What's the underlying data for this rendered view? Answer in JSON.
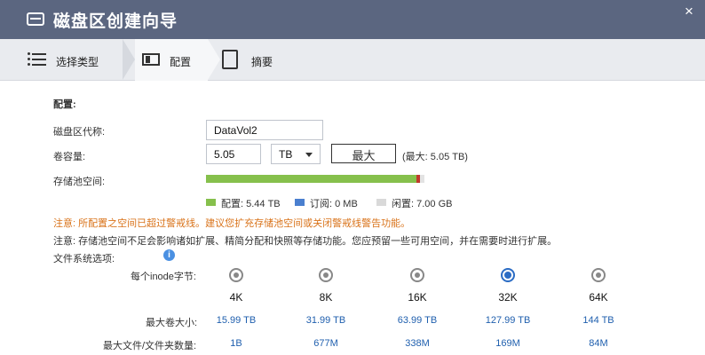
{
  "window": {
    "title": "磁盘区创建向导",
    "close_label": "×"
  },
  "steps": [
    {
      "label": "选择类型",
      "icon": "list-icon"
    },
    {
      "label": "配置",
      "icon": "config-icon"
    },
    {
      "label": "摘要",
      "icon": "summary-icon"
    }
  ],
  "config": {
    "section_title": "配置:",
    "alias_label": "磁盘区代称:",
    "alias_value": "DataVol2",
    "capacity_label": "卷容量:",
    "capacity_value": "5.05",
    "capacity_unit": "TB",
    "max_button": "最大",
    "max_note": "(最大: 5.05 TB)",
    "pool_label": "存储池空间:",
    "pool_used_fraction": 0.98,
    "legend": [
      {
        "label": "配置:   5.44 TB",
        "color": "#86c04c"
      },
      {
        "label": "订阅:   0 MB",
        "color": "#4a7fcf"
      },
      {
        "label": "闲置:   7.00 GB",
        "color": "#d9d9d9"
      }
    ],
    "warning": "注意: 所配置之空间已超过警戒线。建议您扩充存储池空间或关闭警戒线警告功能。",
    "notice": "注意: 存储池空间不足会影响诸如扩展、精简分配和快照等存储功能。您应预留一些可用空间，并在需要时进行扩展。",
    "fs_label": "文件系统选项:",
    "info_icon": "i"
  },
  "inode_table": {
    "row_header_bytes": "每个inode字节:",
    "row_header_volume": "最大卷大小:",
    "row_header_files": "最大文件/文件夹数量:",
    "columns": [
      {
        "size": "4K",
        "max_volume": "15.99 TB",
        "max_files": "1B",
        "selected": false
      },
      {
        "size": "8K",
        "max_volume": "31.99 TB",
        "max_files": "677M",
        "selected": false
      },
      {
        "size": "16K",
        "max_volume": "63.99 TB",
        "max_files": "338M",
        "selected": false
      },
      {
        "size": "32K",
        "max_volume": "127.99 TB",
        "max_files": "169M",
        "selected": true
      },
      {
        "size": "64K",
        "max_volume": "144 TB",
        "max_files": "84M",
        "selected": false
      }
    ]
  }
}
